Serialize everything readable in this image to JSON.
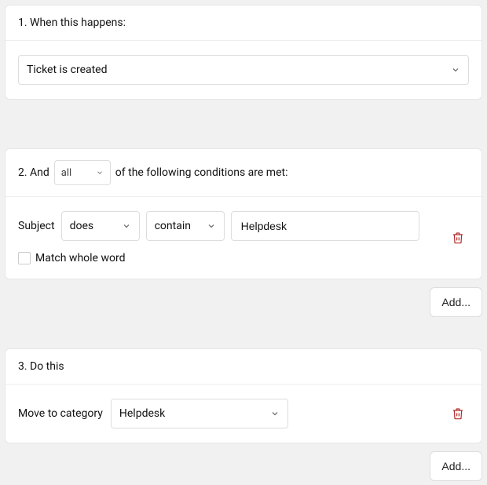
{
  "trigger": {
    "title": "1. When this happens:",
    "event": "Ticket is created"
  },
  "conditions": {
    "titlePrefix": "2. And",
    "scope": "all",
    "titleSuffix": "of the following conditions are met:",
    "rows": [
      {
        "field": "Subject",
        "verb": "does",
        "operator": "contain",
        "value": "Helpdesk",
        "matchWholeWordLabel": "Match whole word"
      }
    ],
    "addLabel": "Add..."
  },
  "actions": {
    "title": "3. Do this",
    "rows": [
      {
        "action": "Move to category",
        "value": "Helpdesk"
      }
    ],
    "addLabel": "Add..."
  }
}
